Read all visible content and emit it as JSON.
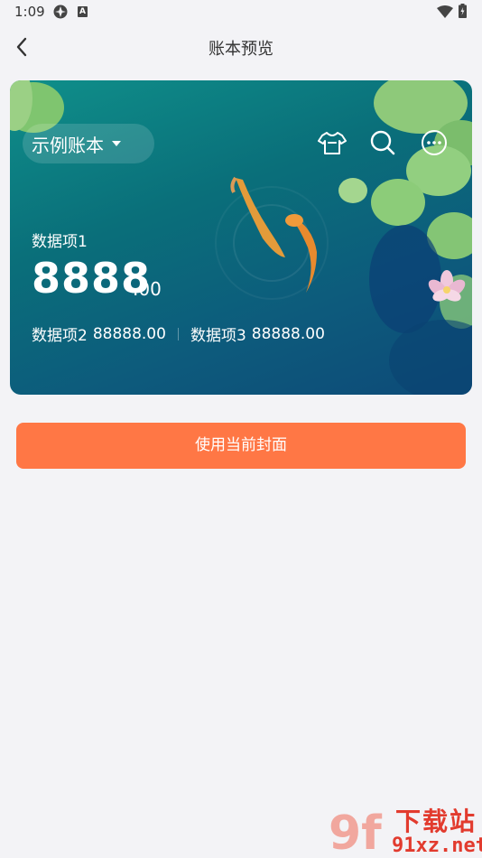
{
  "status_bar": {
    "time": "1:09",
    "icon_a": "A"
  },
  "nav": {
    "title": "账本预览"
  },
  "card": {
    "book_name": "示例账本",
    "item1_label": "数据项1",
    "amount_int": "8888",
    "amount_dec": ".00",
    "item2_label": "数据项2",
    "item2_value": "88888.00",
    "item3_label": "数据项3",
    "item3_value": "88888.00"
  },
  "button": {
    "label": "使用当前封面"
  },
  "watermark": {
    "title": "下载站",
    "domain": "91xz.net",
    "logo": "9f"
  },
  "colors": {
    "accent": "#ff7745",
    "background": "#f3f3f6",
    "card": "#0d6d7a"
  }
}
